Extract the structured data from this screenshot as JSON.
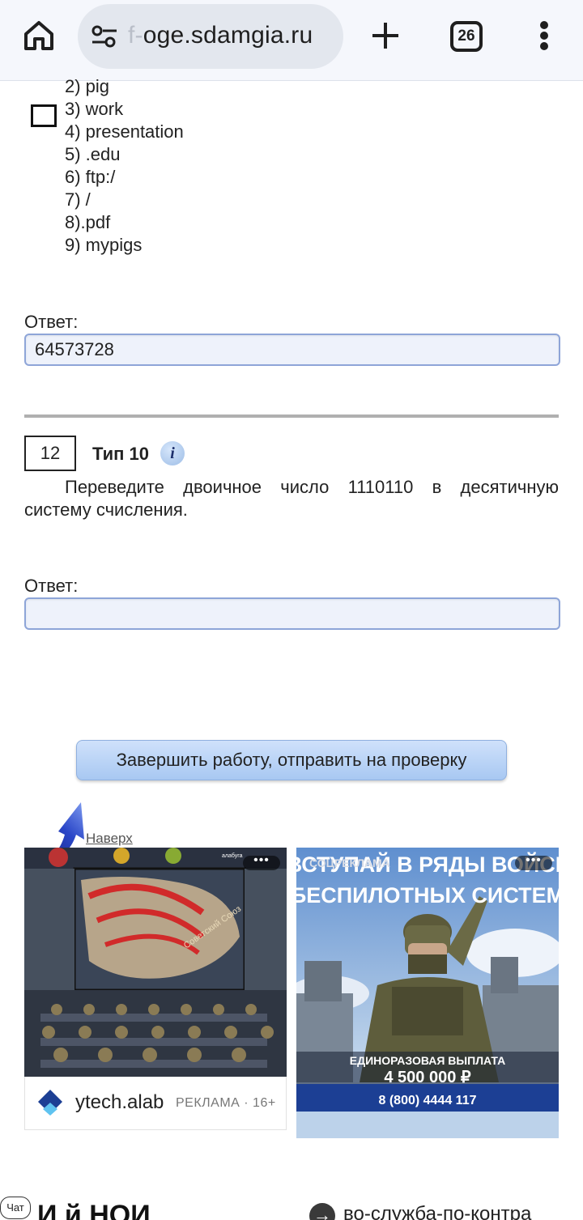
{
  "browser": {
    "url_faded_prefix": "f-",
    "url_domain": "oge.sdamgia.ru",
    "tab_count": "26"
  },
  "previous_task": {
    "options": [
      "2)  pig",
      "3)  work",
      "4)  presentation",
      "5)  .edu",
      "6)  ftp:/",
      "7)  /",
      "8).pdf",
      "9)  mypigs"
    ],
    "answer_label": "Ответ:",
    "answer_value": "64573728"
  },
  "task": {
    "number": "12",
    "type": "Тип 10",
    "info_glyph": "i",
    "text": "Переведите двоичное число 1110110 в десятичную систему счисления.",
    "answer_label": "Ответ:",
    "answer_value": ""
  },
  "submit_label": "Завершить работу, отправить на проверку",
  "top_link": "Наверх",
  "ads": {
    "left": {
      "logo_text": "алабуга",
      "map_label": "Советский Союз",
      "domain": "ytech.alab",
      "label": "РЕКЛАМА · 16+",
      "headline": "И      й    НОИ"
    },
    "right": {
      "badge": "СОЦРЕКЛАМА",
      "title_line1": "ВСТУПАЙ В РЯДЫ ВОЙСК",
      "title_line2": "БЕСПИЛОТНЫХ СИСТЕМ",
      "payment_label": "ЕДИНОРАЗОВАЯ ВЫПЛАТА",
      "payment_amount": "4 500 000 ₽",
      "phone": "8 (800) 4444 117",
      "domain": "во-служба-по-контра"
    }
  },
  "chat_label": "Чат",
  "colors": {
    "accent_blue": "#a8c8f2",
    "input_border": "#8ea5d8",
    "ad_red": "#d12a2a",
    "ad_blue": "#1c3f94"
  }
}
